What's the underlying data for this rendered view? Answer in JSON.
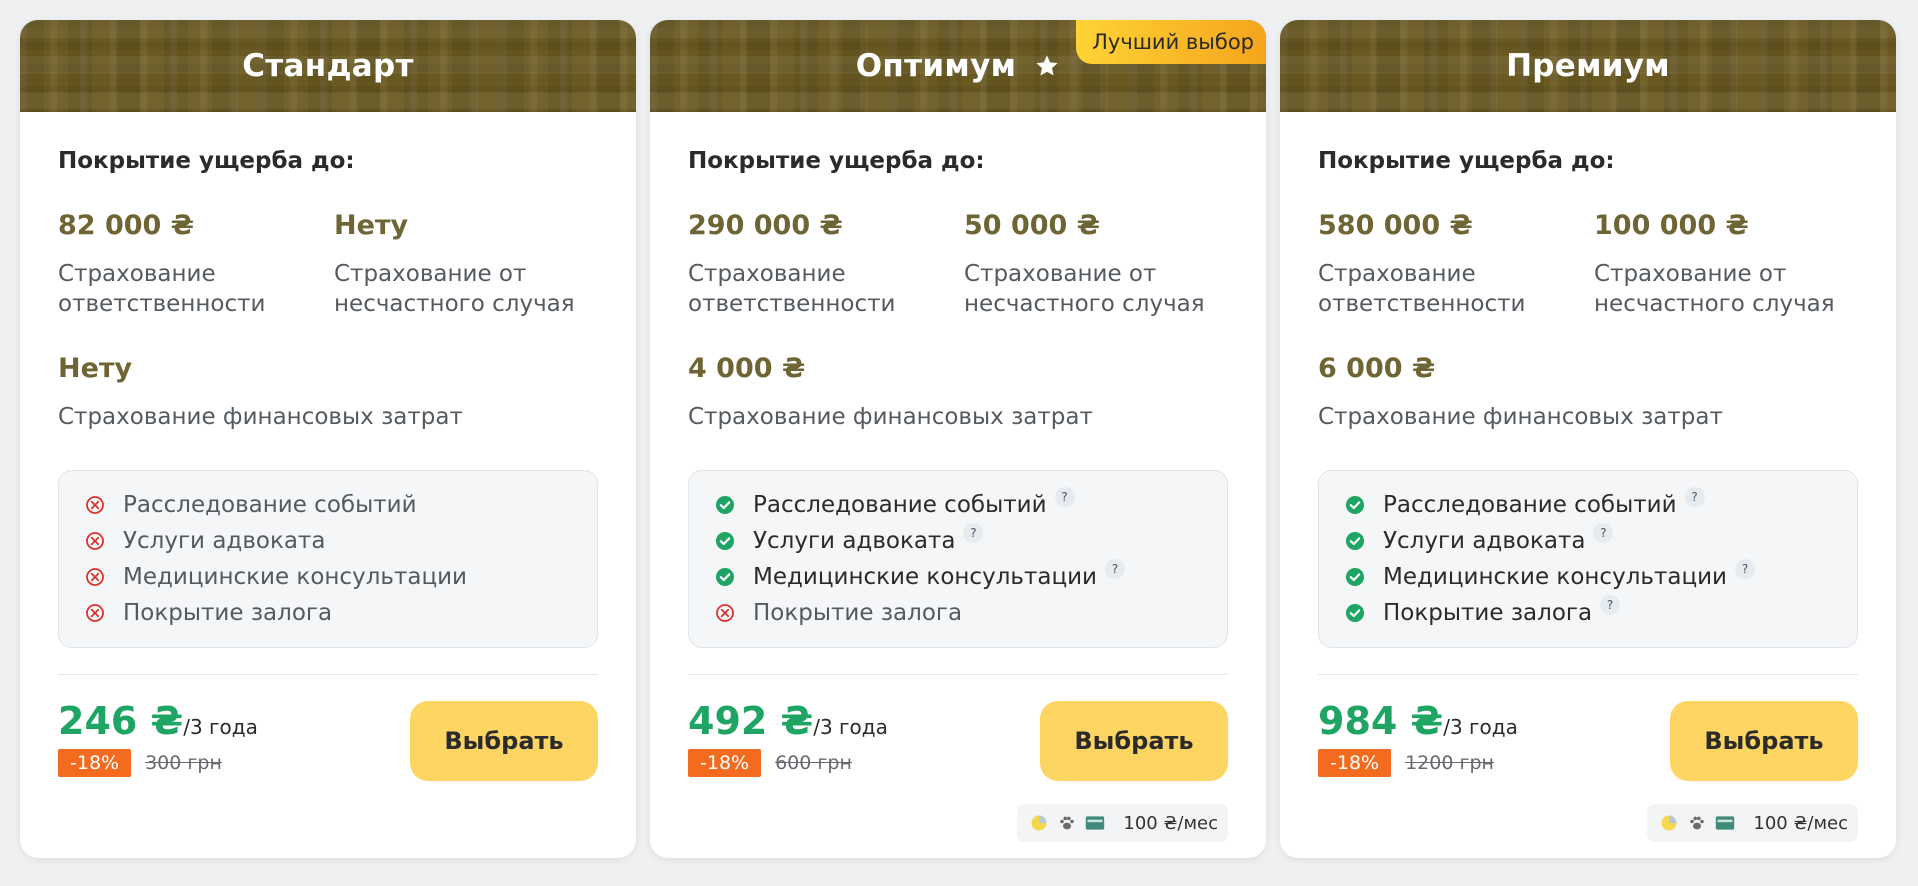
{
  "plans": [
    {
      "title": "Стандарт",
      "badge": "",
      "coverage_title": "Покрытие ущерба до:",
      "coverage": [
        {
          "amount": "82 000 ₴",
          "desc": "Страхование ответственности"
        },
        {
          "amount": "Нету",
          "desc": "Страхование от несчастного случая"
        },
        {
          "amount": "Нету",
          "desc": "Страхование финансовых затрат"
        }
      ],
      "features": [
        {
          "label": "Расследование событий",
          "included": false
        },
        {
          "label": "Услуги адвоката",
          "included": false
        },
        {
          "label": "Медицинские консультации",
          "included": false
        },
        {
          "label": "Покрытие залога",
          "included": false
        }
      ],
      "price": "246 ₴",
      "period": "/3 года",
      "discount": "-18%",
      "old_price": "300 грн",
      "button": "Выбрать",
      "addon_price": ""
    },
    {
      "title": "Оптимум",
      "badge": "Лучший выбор",
      "coverage_title": "Покрытие ущерба до:",
      "coverage": [
        {
          "amount": "290 000 ₴",
          "desc": "Страхование ответственности"
        },
        {
          "amount": "50 000 ₴",
          "desc": "Страхование от несчастного случая"
        },
        {
          "amount": "4 000 ₴",
          "desc": "Страхование финансовых затрат"
        }
      ],
      "features": [
        {
          "label": "Расследование событий",
          "included": true
        },
        {
          "label": "Услуги адвоката",
          "included": true
        },
        {
          "label": "Медицинские консультации",
          "included": true
        },
        {
          "label": "Покрытие залога",
          "included": false
        }
      ],
      "price": "492 ₴",
      "period": "/3 года",
      "discount": "-18%",
      "old_price": "600 грн",
      "button": "Выбрать",
      "addon_price": "100 ₴/мес"
    },
    {
      "title": "Премиум",
      "badge": "",
      "coverage_title": "Покрытие ущерба до:",
      "coverage": [
        {
          "amount": "580 000 ₴",
          "desc": "Страхование ответственности"
        },
        {
          "amount": "100 000 ₴",
          "desc": "Страхование от несчастного случая"
        },
        {
          "amount": "6 000 ₴",
          "desc": "Страхование финансовых затрат"
        }
      ],
      "features": [
        {
          "label": "Расследование событий",
          "included": true
        },
        {
          "label": "Услуги адвоката",
          "included": true
        },
        {
          "label": "Медицинские консультации",
          "included": true
        },
        {
          "label": "Покрытие залога",
          "included": true
        }
      ],
      "price": "984 ₴",
      "period": "/3 года",
      "discount": "-18%",
      "old_price": "1200 грн",
      "button": "Выбрать",
      "addon_price": "100 ₴/мес"
    }
  ],
  "icons": {
    "star": "star-icon",
    "included": "check-circle-icon",
    "excluded": "x-circle-icon",
    "help": "question-icon",
    "addon": [
      "pie-chart-icon",
      "paw-icon",
      "card-icon"
    ]
  },
  "colors": {
    "header": "#6a5a22",
    "amount": "#6f6534",
    "price": "#1ea463",
    "discount": "#f26b1e",
    "button": "#fdd562",
    "check": "#1ea463",
    "cross": "#d9342b"
  }
}
